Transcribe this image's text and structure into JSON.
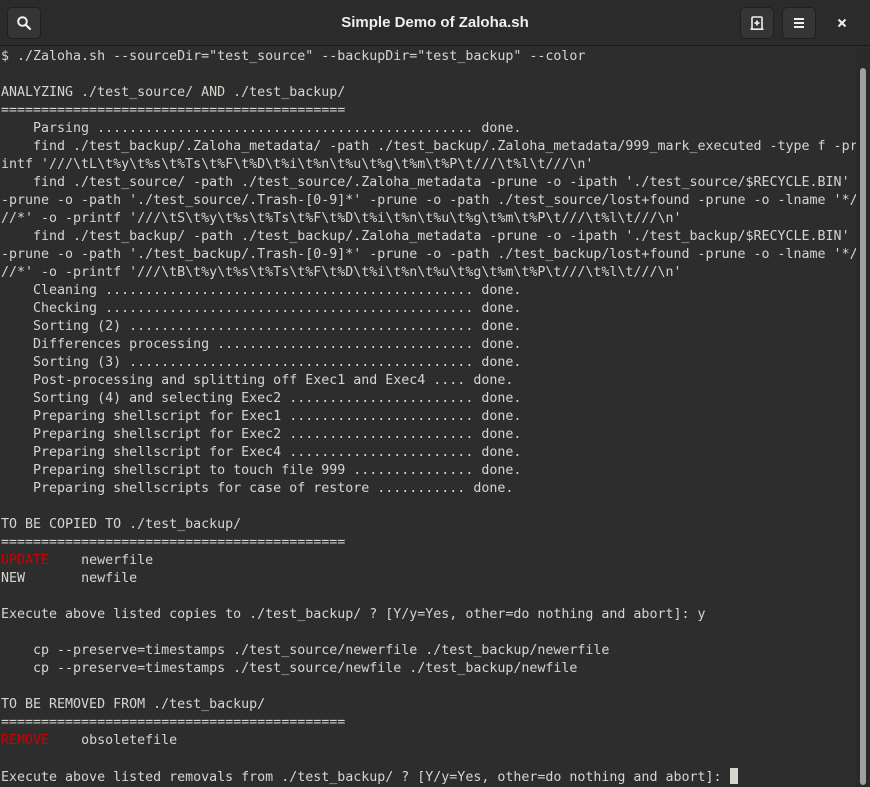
{
  "window": {
    "title": "Simple Demo of Zaloha.sh",
    "buttons": {
      "search": "search-icon",
      "new_tab": "new-tab-icon",
      "menu": "hamburger-menu-icon",
      "close": "close-icon"
    }
  },
  "colors": {
    "background": "#2d2d2d",
    "foreground": "#d3d7cf",
    "red": "#cc0000"
  },
  "terminal": {
    "lines": [
      "$ ./Zaloha.sh --sourceDir=\"test_source\" --backupDir=\"test_backup\" --color",
      "",
      "ANALYZING ./test_source/ AND ./test_backup/",
      "===========================================",
      "    Parsing ............................................... done.",
      "    find ./test_backup/.Zaloha_metadata/ -path ./test_backup/.Zaloha_metadata/999_mark_executed -type f -pr",
      "intf '///\\tL\\t%y\\t%s\\t%Ts\\t%F\\t%D\\t%i\\t%n\\t%u\\t%g\\t%m\\t%P\\t///\\t%l\\t///\\n'",
      "    find ./test_source/ -path ./test_source/.Zaloha_metadata -prune -o -ipath './test_source/$RECYCLE.BIN'",
      "-prune -o -path './test_source/.Trash-[0-9]*' -prune -o -path ./test_source/lost+found -prune -o -lname '*/",
      "//*' -o -printf '///\\tS\\t%y\\t%s\\t%Ts\\t%F\\t%D\\t%i\\t%n\\t%u\\t%g\\t%m\\t%P\\t///\\t%l\\t///\\n'",
      "    find ./test_backup/ -path ./test_backup/.Zaloha_metadata -prune -o -ipath './test_backup/$RECYCLE.BIN'",
      "-prune -o -path './test_backup/.Trash-[0-9]*' -prune -o -path ./test_backup/lost+found -prune -o -lname '*/",
      "//*' -o -printf '///\\tB\\t%y\\t%s\\t%Ts\\t%F\\t%D\\t%i\\t%n\\t%u\\t%g\\t%m\\t%P\\t///\\t%l\\t///\\n'",
      "    Cleaning .............................................. done.",
      "    Checking .............................................. done.",
      "    Sorting (2) ........................................... done.",
      "    Differences processing ................................ done.",
      "    Sorting (3) ........................................... done.",
      "    Post-processing and splitting off Exec1 and Exec4 .... done.",
      "    Sorting (4) and selecting Exec2 ....................... done.",
      "    Preparing shellscript for Exec1 ....................... done.",
      "    Preparing shellscript for Exec2 ....................... done.",
      "    Preparing shellscript for Exec4 ....................... done.",
      "    Preparing shellscript to touch file 999 ............... done.",
      "    Preparing shellscripts for case of restore ........... done.",
      "",
      "TO BE COPIED TO ./test_backup/",
      "==========================================="
    ],
    "copy_items": [
      {
        "action": "UPDATE",
        "action_red": true,
        "pad": "    ",
        "file": "newerfile"
      },
      {
        "action": "NEW",
        "action_red": false,
        "pad": "       ",
        "file": "newfile"
      }
    ],
    "lines_after_copy": [
      "",
      "Execute above listed copies to ./test_backup/ ? [Y/y=Yes, other=do nothing and abort]: y",
      "",
      "    cp --preserve=timestamps ./test_source/newerfile ./test_backup/newerfile",
      "    cp --preserve=timestamps ./test_source/newfile ./test_backup/newfile",
      "",
      "TO BE REMOVED FROM ./test_backup/",
      "==========================================="
    ],
    "remove_items": [
      {
        "action": "REMOVE",
        "action_red": true,
        "pad": "    ",
        "file": "obsoletefile"
      }
    ],
    "lines_after_remove": [
      ""
    ],
    "prompt": "Execute above listed removals from ./test_backup/ ? [Y/y=Yes, other=do nothing and abort]: "
  }
}
